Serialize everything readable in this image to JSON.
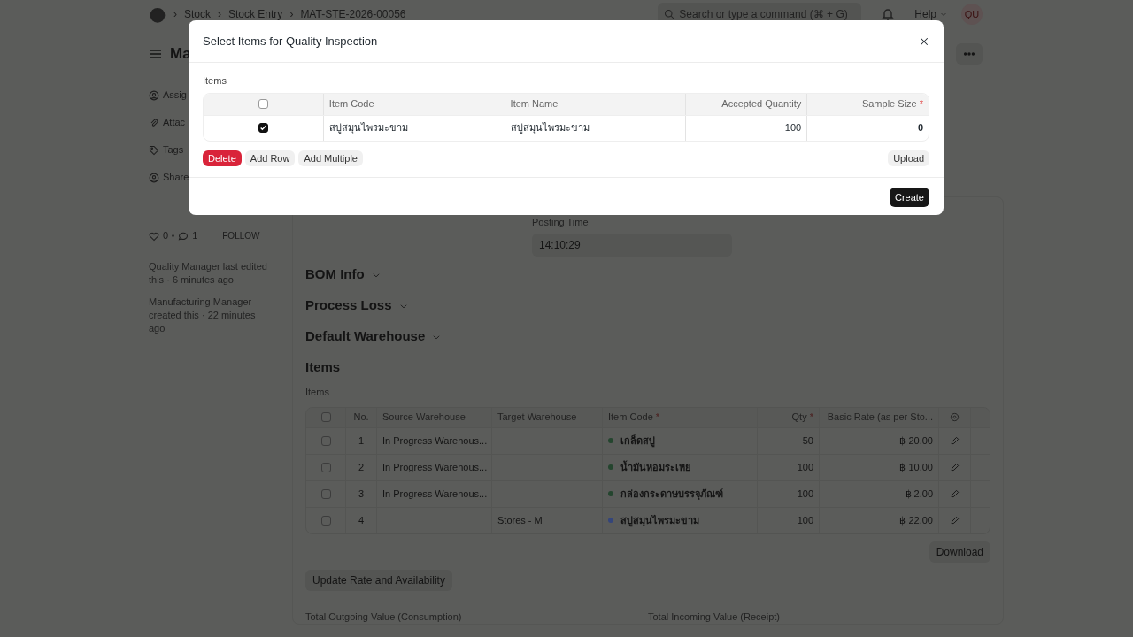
{
  "navbar": {
    "breadcrumbs": [
      {
        "separator": "›",
        "label": "Stock"
      },
      {
        "separator": "›",
        "label": "Stock Entry"
      },
      {
        "separator": "›",
        "label": "MAT-STE-2026-00056"
      }
    ],
    "search": {
      "placeholder": "Search or type a command (⌘ + G)"
    },
    "help": "Help",
    "avatar": "QU"
  },
  "page": {
    "title": "Ma"
  },
  "sidebar": {
    "actions": [
      {
        "label": "Assig",
        "kind": "assign"
      },
      {
        "label": "Attac",
        "kind": "attach"
      },
      {
        "label": "Tags",
        "kind": "tag"
      },
      {
        "label": "Share",
        "kind": "share"
      }
    ],
    "likes": "0",
    "comments": "1",
    "follow": "FOLLOW",
    "activity": [
      "Quality Manager last edited this · 6 minutes ago",
      "Manufacturing Manager created this · 22 minutes ago"
    ]
  },
  "form": {
    "posting_time": {
      "label": "Posting Time",
      "value": "14:10:29"
    },
    "sections": [
      "BOM Info",
      "Process Loss",
      "Default Warehouse"
    ],
    "items": {
      "title": "Items",
      "label": "Items",
      "select_all": {
        "checked": false
      },
      "columns": [
        {
          "label": "No."
        },
        {
          "label": "Source Warehouse"
        },
        {
          "label": "Target Warehouse"
        },
        {
          "label": "Item Code",
          "required": "*"
        },
        {
          "label": "Qty",
          "required": "*"
        },
        {
          "label": "Basic Rate (as per Sto..."
        }
      ],
      "rows": [
        {
          "checked": false,
          "no": "1",
          "source": "In Progress Warehous...",
          "target": "",
          "item_code": "เกล็ดสบู่",
          "color": "#24452e",
          "qty": "50",
          "rate": "฿ 20.00"
        },
        {
          "checked": false,
          "no": "2",
          "source": "In Progress Warehous...",
          "target": "",
          "item_code": "น้ำมันหอมระเหย",
          "color": "#24452e",
          "qty": "100",
          "rate": "฿ 10.00"
        },
        {
          "checked": false,
          "no": "3",
          "source": "In Progress Warehous...",
          "target": "",
          "item_code": "กล่องกระดาษบรรจุภัณฑ์",
          "color": "#24452e",
          "qty": "100",
          "rate": "฿ 2.00"
        },
        {
          "checked": false,
          "no": "4",
          "source": "",
          "target": "Stores - M",
          "item_code": "สบู่สมุนไพรมะขาม",
          "color": "#34457a",
          "qty": "100",
          "rate": "฿ 22.00"
        }
      ],
      "download": "Download"
    },
    "update_button": "Update Rate and Availability",
    "totals": [
      "Total Outgoing Value (Consumption)",
      "Total Incoming Value (Receipt)"
    ]
  },
  "dialog": {
    "title": "Select Items for Quality Inspection",
    "table_label": "Items",
    "select_all": {
      "checked": false
    },
    "columns": [
      {
        "label": "Item Code",
        "kind": "text"
      },
      {
        "label": "Item Name",
        "kind": "text"
      },
      {
        "label": "Accepted Quantity",
        "kind": "number"
      },
      {
        "label": "Sample Size",
        "kind": "number",
        "required": "*"
      }
    ],
    "rows": [
      {
        "selected": true,
        "cells": [
          "สบู่สมุนไพรมะขาม",
          "สบู่สมุนไพรมะขาม",
          "100",
          "0"
        ]
      }
    ],
    "buttons": [
      {
        "label": "Delete",
        "kind": "danger"
      },
      {
        "label": "Add Row",
        "kind": "default"
      },
      {
        "label": "Add Multiple",
        "kind": "default"
      }
    ],
    "upload": "Upload",
    "primary": "Create"
  }
}
